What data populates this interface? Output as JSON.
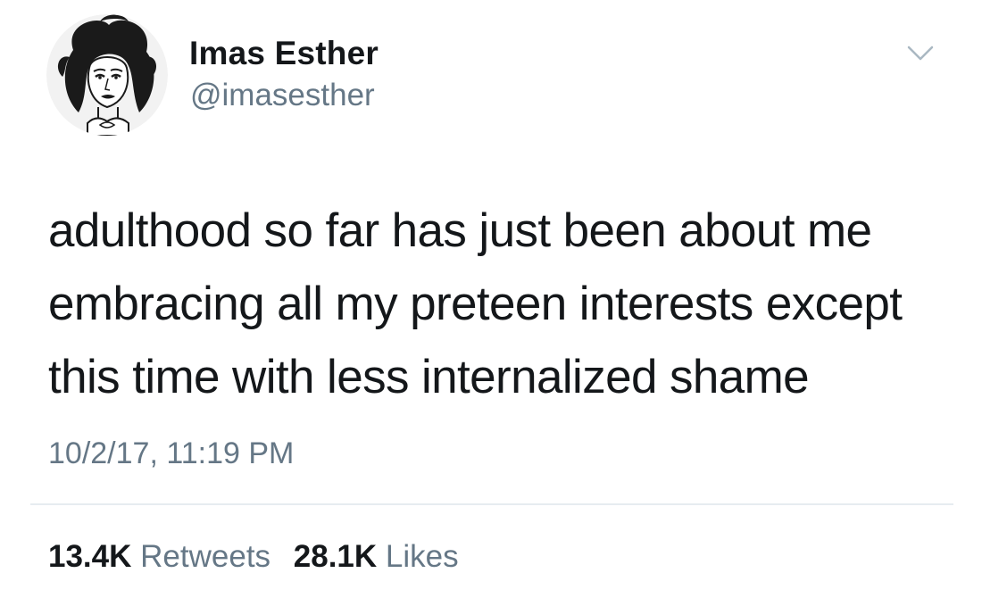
{
  "user": {
    "display_name": "Imas Esther",
    "handle": "@imasesther"
  },
  "tweet": {
    "text": "adulthood so far has just been about me\nembracing all my preteen interests except\nthis time with less internalized shame",
    "timestamp": "10/2/17, 11:19 PM"
  },
  "stats": {
    "retweets_count": "13.4K",
    "retweets_label": "Retweets",
    "likes_count": "28.1K",
    "likes_label": "Likes"
  },
  "icons": {
    "more": "chevron-down-icon",
    "avatar": "avatar-illustration"
  },
  "colors": {
    "text_primary": "#14171a",
    "text_secondary": "#657786",
    "divider": "#e6ecf0",
    "background": "#ffffff"
  }
}
